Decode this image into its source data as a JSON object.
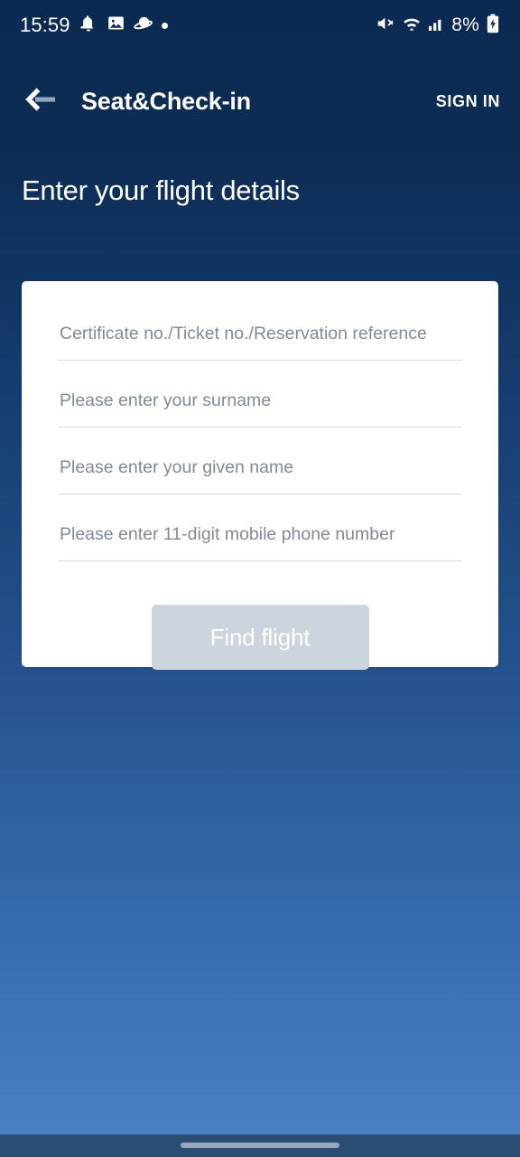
{
  "status_bar": {
    "time": "15:59",
    "battery_percent": "8%",
    "left_icons": [
      {
        "name": "notification-silenced-icon"
      },
      {
        "name": "image-icon"
      },
      {
        "name": "planet-icon"
      },
      {
        "name": "dot-indicator-icon"
      }
    ],
    "right_icons": [
      {
        "name": "volume-mute-icon"
      },
      {
        "name": "wifi-icon"
      },
      {
        "name": "cellular-signal-icon"
      },
      {
        "name": "battery-charging-icon"
      }
    ]
  },
  "app_bar": {
    "back_icon": "back-arrow-icon",
    "title": "Seat&Check-in",
    "sign_in_label": "SIGN IN"
  },
  "page": {
    "heading": "Enter your flight details"
  },
  "form": {
    "fields": [
      {
        "name": "certificate-ticket-reservation",
        "placeholder": "Certificate no./Ticket no./Reservation reference",
        "value": ""
      },
      {
        "name": "surname",
        "placeholder": "Please enter your surname",
        "value": ""
      },
      {
        "name": "given-name",
        "placeholder": "Please enter your given name",
        "value": ""
      },
      {
        "name": "mobile-phone",
        "placeholder": "Please enter 11-digit mobile phone number",
        "value": ""
      }
    ],
    "submit_label": "Find flight",
    "submit_state": "disabled"
  },
  "nav_bar": {
    "gesture_pill": "home-gesture-pill"
  },
  "colors": {
    "background_top": "#0b2a52",
    "background_bottom": "#4a7fc1",
    "card": "#ffffff",
    "submit_disabled": "#ccd4dd",
    "placeholder_text": "#818a93",
    "underline": "#d9dde1",
    "nav_bar": "#2b4d74"
  }
}
